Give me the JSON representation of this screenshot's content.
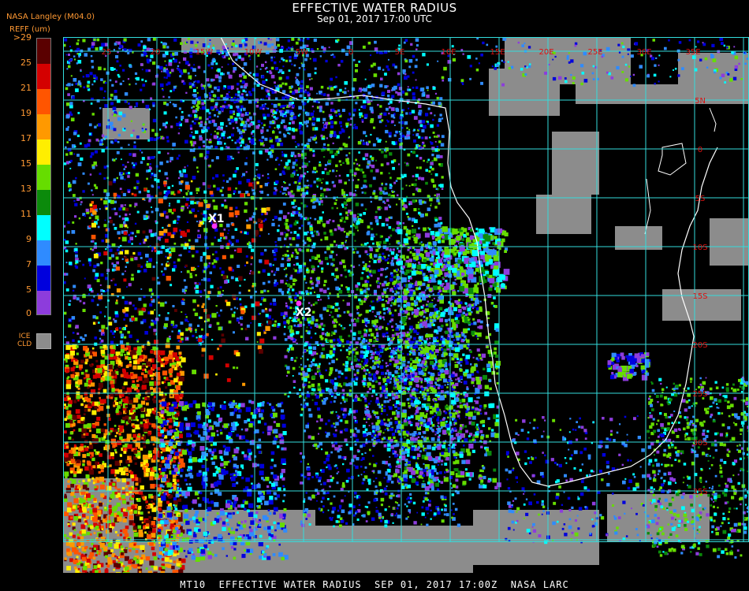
{
  "header": {
    "title": "EFFECTIVE WATER RADIUS",
    "subtitle": "Sep 01, 2017 17:00 UTC"
  },
  "legend": {
    "org": "NASA Langley (M04.0)",
    "units": "REFF (um)",
    "ticks": [
      ">29",
      "25",
      "21",
      "19",
      "17",
      "15",
      "13",
      "11",
      "9",
      "7",
      "5",
      "0"
    ],
    "swatches": [
      "#5a0000",
      "#d40000",
      "#ff5500",
      "#ff9900",
      "#ffee00",
      "#66dd00",
      "#0b8a0b",
      "#00ffff",
      "#2f8bff",
      "#0000dd",
      "#8d3cdc"
    ],
    "ice_label_1": "ICE",
    "ice_label_2": "CLD",
    "ice_color": "#8c8c8c"
  },
  "map": {
    "lon_labels": [
      "25",
      "20",
      "15W",
      "10W",
      "5W",
      "0",
      "5E",
      "10E",
      "15E",
      "20E",
      "25E",
      "30E",
      "35E"
    ],
    "lat_labels": [
      "5N",
      "0",
      "5S",
      "10S",
      "15S",
      "20S",
      "25S",
      "30S",
      "35S",
      "40S"
    ],
    "markers": [
      {
        "label": "X1",
        "color": "#ff33ff"
      },
      {
        "label": "X2",
        "color": "#ff33ff"
      }
    ],
    "grid_color": "#33dddd",
    "coast_color": "#ffffff"
  },
  "footer": {
    "text": "MT10  EFFECTIVE WATER RADIUS  SEP 01, 2017 17:00Z  NASA LARC"
  }
}
